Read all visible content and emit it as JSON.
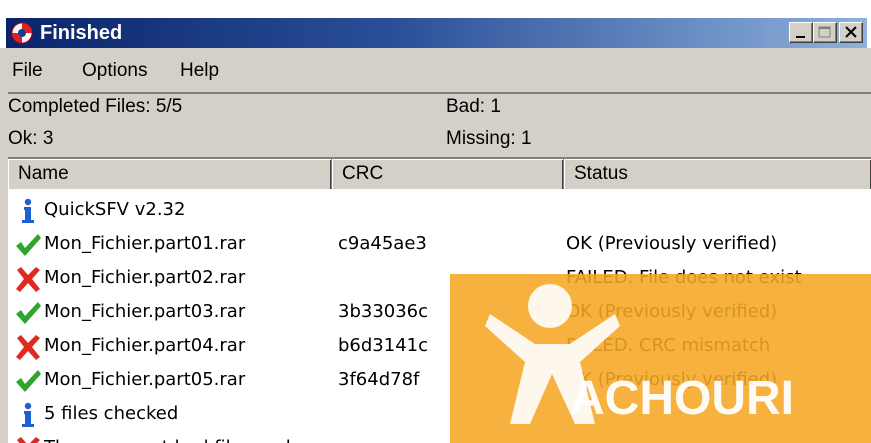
{
  "window": {
    "title": "Finished"
  },
  "menu": [
    "File",
    "Options",
    "Help"
  ],
  "summary": {
    "completed": "Completed Files: 5/5",
    "bad": "Bad: 1",
    "ok": "Ok: 3",
    "missing": "Missing: 1"
  },
  "columns": [
    "Name",
    "CRC",
    "Status"
  ],
  "rows": [
    {
      "icon": "info-icon",
      "name": "QuickSFV v2.32",
      "crc": "",
      "status": ""
    },
    {
      "icon": "check-icon",
      "name": "Mon_Fichier.part01.rar",
      "crc": "c9a45ae3",
      "status": "OK (Previously verified)"
    },
    {
      "icon": "cross-icon",
      "name": "Mon_Fichier.part02.rar",
      "crc": "",
      "status": "FAILED.  File does not exist"
    },
    {
      "icon": "check-icon",
      "name": "Mon_Fichier.part03.rar",
      "crc": "3b33036c",
      "status": "OK (Previously verified)"
    },
    {
      "icon": "cross-icon",
      "name": "Mon_Fichier.part04.rar",
      "crc": "b6d3141c",
      "status": "FAILED.  CRC mismatch"
    },
    {
      "icon": "check-icon",
      "name": "Mon_Fichier.part05.rar",
      "crc": "3f64d78f",
      "status": "OK (Previously verified)"
    },
    {
      "icon": "info-icon",
      "name": "5 files checked",
      "crc": "",
      "status": ""
    },
    {
      "icon": "cross-icon",
      "name": "There were at bad files and",
      "crc": "",
      "status": ""
    }
  ],
  "colors": {
    "ok": "#2fa52f",
    "fail": "#e02a20",
    "info": "#1f5fd6",
    "watermark": "#f5a623",
    "title_start": "#0a246a",
    "title_end": "#8fb1dc"
  }
}
